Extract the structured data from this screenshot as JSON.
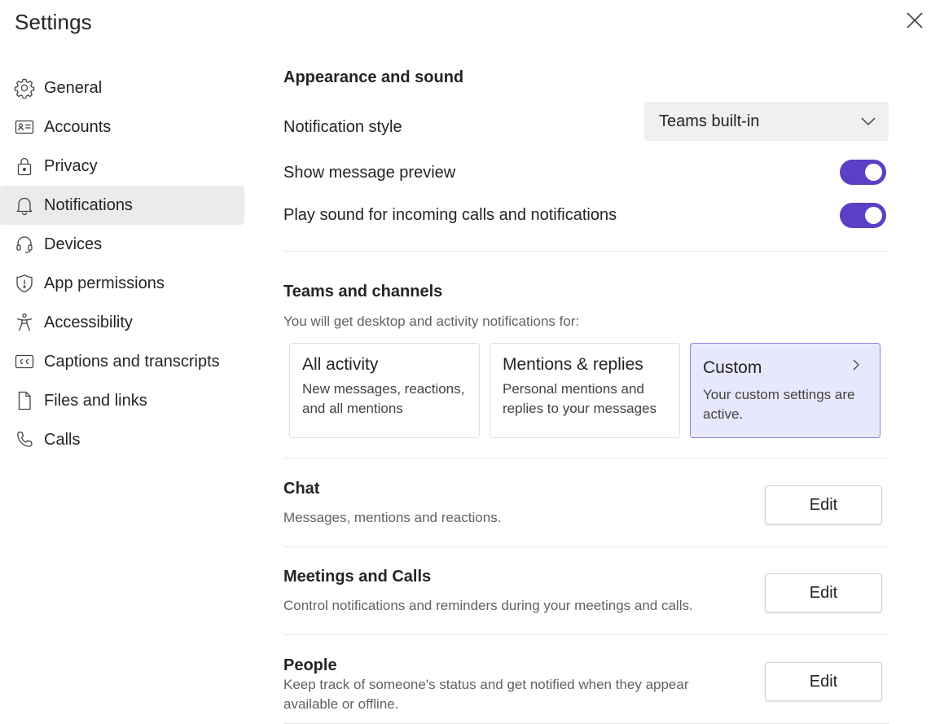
{
  "window": {
    "title": "Settings",
    "close_icon": "close-icon"
  },
  "sidebar": {
    "items": [
      {
        "label": "General",
        "icon": "gear-icon"
      },
      {
        "label": "Accounts",
        "icon": "id-card-icon"
      },
      {
        "label": "Privacy",
        "icon": "lock-icon"
      },
      {
        "label": "Notifications",
        "icon": "bell-icon",
        "active": true
      },
      {
        "label": "Devices",
        "icon": "headset-icon"
      },
      {
        "label": "App permissions",
        "icon": "shield-icon"
      },
      {
        "label": "Accessibility",
        "icon": "accessibility-icon"
      },
      {
        "label": "Captions and transcripts",
        "icon": "closed-captions-icon"
      },
      {
        "label": "Files and links",
        "icon": "document-icon"
      },
      {
        "label": "Calls",
        "icon": "phone-icon"
      }
    ]
  },
  "appearance": {
    "title": "Appearance and sound",
    "notification_style_label": "Notification style",
    "notification_style_value": "Teams built-in",
    "show_preview_label": "Show message preview",
    "show_preview_on": true,
    "play_sound_label": "Play sound for incoming calls and notifications",
    "play_sound_on": true
  },
  "teams_channels": {
    "title": "Teams and channels",
    "subtitle": "You will get desktop and activity notifications for:",
    "options": [
      {
        "title": "All activity",
        "desc_line1": "New messages, reactions,",
        "desc_line2": "and all mentions",
        "selected": false
      },
      {
        "title": "Mentions & replies",
        "desc_line1": "Personal mentions and",
        "desc_line2": "replies to your messages",
        "selected": false
      },
      {
        "title": "Custom",
        "desc_line1": "Your custom settings are",
        "desc_line2": "active.",
        "selected": true
      }
    ]
  },
  "chat": {
    "title": "Chat",
    "desc": "Messages, mentions and reactions.",
    "edit_label": "Edit"
  },
  "meetings": {
    "title": "Meetings and Calls",
    "desc": "Control notifications and reminders during your meetings and calls.",
    "edit_label": "Edit"
  },
  "people": {
    "title": "People",
    "desc_line1": "Keep track of someone's status and get notified when they appear",
    "desc_line2": "available or offline.",
    "edit_label": "Edit"
  },
  "colors": {
    "accent": "#5b3fc4",
    "selected_card_bg": "#e8e8fc",
    "active_sidebar_bg": "#ebebeb"
  }
}
